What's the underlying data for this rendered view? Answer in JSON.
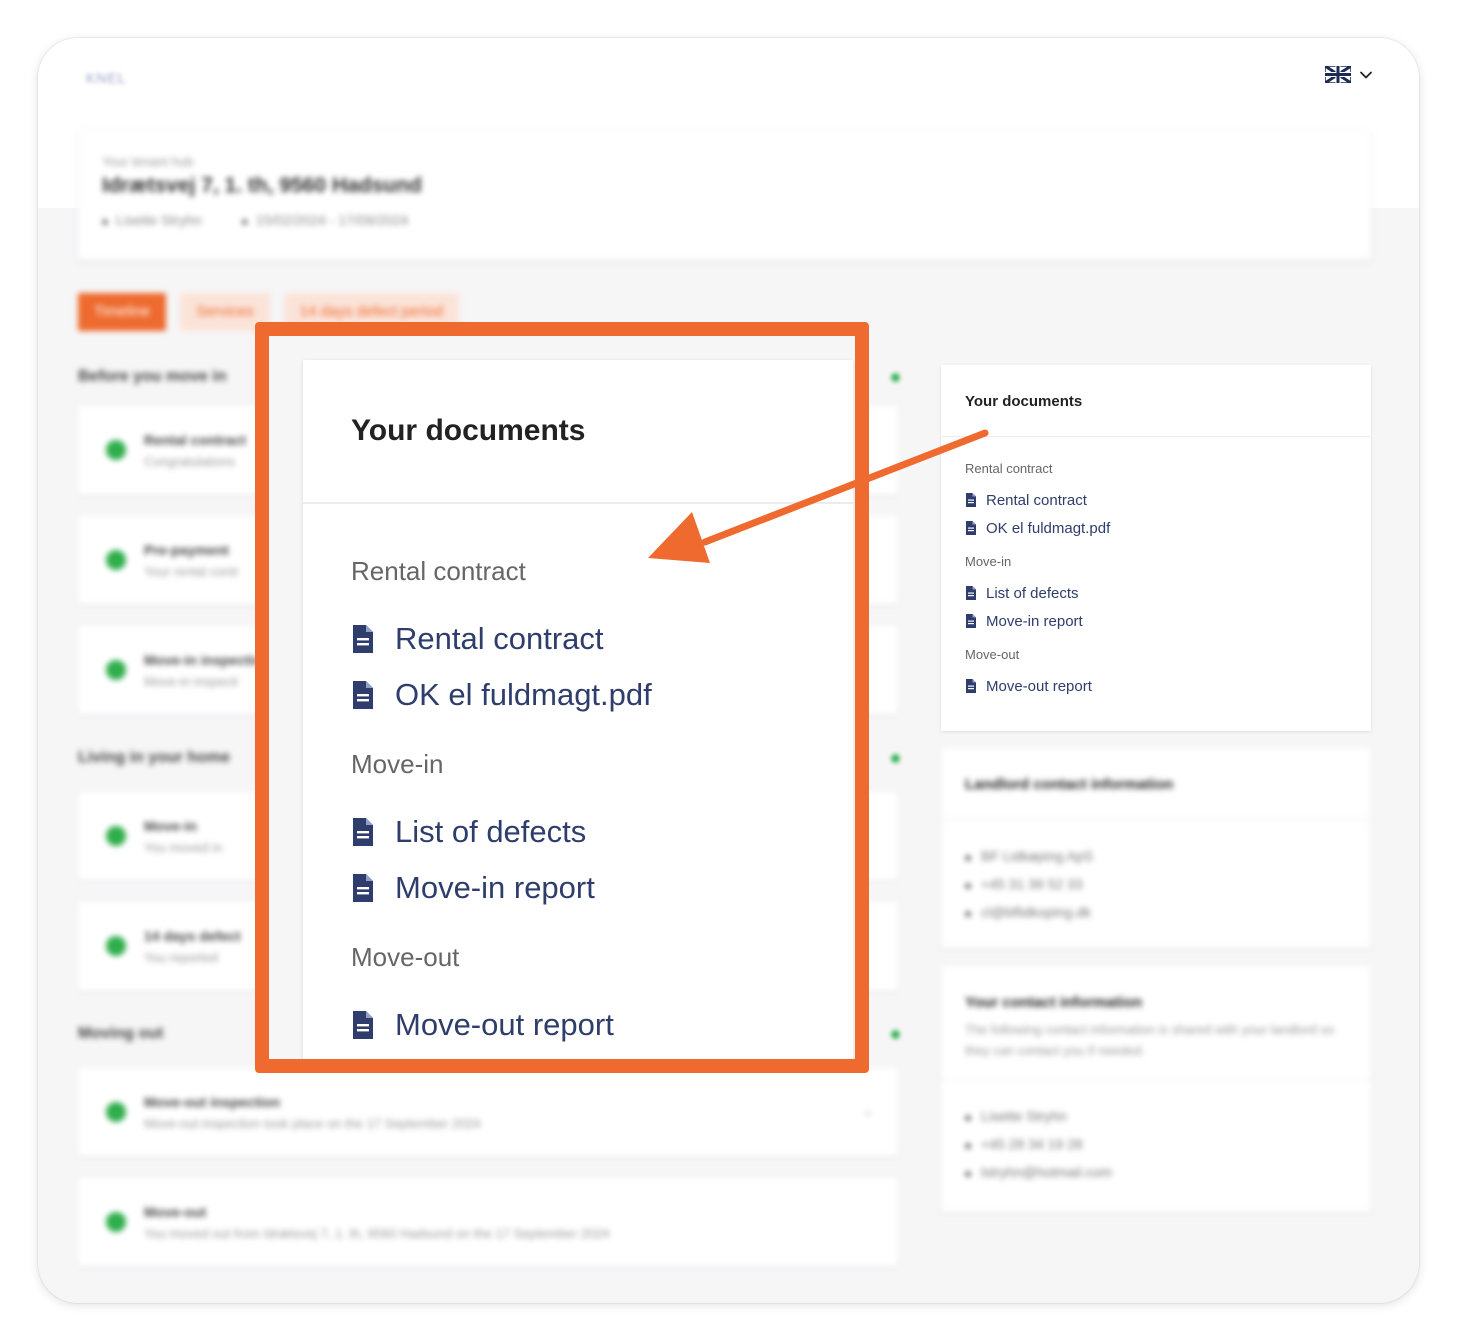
{
  "app": {
    "logo": "KNEL",
    "language_flag_icon": "uk-flag-icon",
    "language_chevron_icon": "chevron-down-icon"
  },
  "hero": {
    "label": "Your tenant hub",
    "address": "Idrætsvej 7, 1. th, 9560 Hadsund",
    "tenant": "Lisette Stryhn",
    "period": "15/02/2024 - 17/09/2024"
  },
  "tabs": [
    {
      "label": "Timeline",
      "active": true
    },
    {
      "label": "Services",
      "active": false
    },
    {
      "label": "14 days defect period",
      "active": false
    }
  ],
  "timeline": {
    "sections": [
      {
        "title": "Before you move in"
      },
      {
        "title": "Living in your home"
      },
      {
        "title": "Moving out"
      }
    ],
    "steps": [
      {
        "title": "Rental contract",
        "desc": "Congratulations"
      },
      {
        "title": "Pre-payment",
        "desc": "Your rental contr"
      },
      {
        "title": "Move-in inspection",
        "desc": "Move-in inspecti"
      },
      {
        "title": "Move-in",
        "desc": "You moved in"
      },
      {
        "title": "14 days defect",
        "desc": "You reported"
      },
      {
        "title": "Move-out inspection",
        "desc": "Move-out inspection took place on the 17 September 2024"
      },
      {
        "title": "Move-out",
        "desc": "You moved out from Idrætsvej 7, 1. th, 9560 Hadsund on the 17 September 2024"
      }
    ]
  },
  "documents": {
    "title": "Your documents",
    "groups": [
      {
        "label": "Rental contract",
        "items": [
          "Rental contract",
          "OK el fuldmagt.pdf"
        ]
      },
      {
        "label": "Move-in",
        "items": [
          "List of defects",
          "Move-in report"
        ]
      },
      {
        "label": "Move-out",
        "items": [
          "Move-out report"
        ]
      }
    ],
    "file_icon": "file-text-icon"
  },
  "landlord": {
    "title": "Landlord contact information",
    "name": "BF Lidkøping ApS",
    "phone": "+45 31 39 52 33",
    "email": "cl@bflidkoping.dk"
  },
  "contact": {
    "title": "Your contact information",
    "desc": "The following contact information is shared with your landlord so they can contact you if needed.",
    "name": "Lisette Stryhn",
    "phone": "+45 28 34 19 28",
    "email": "lstryhn@hotmail.com"
  },
  "colors": {
    "accent": "#ee6a2e",
    "link": "#2e3d6b",
    "success": "#2fae4c"
  }
}
